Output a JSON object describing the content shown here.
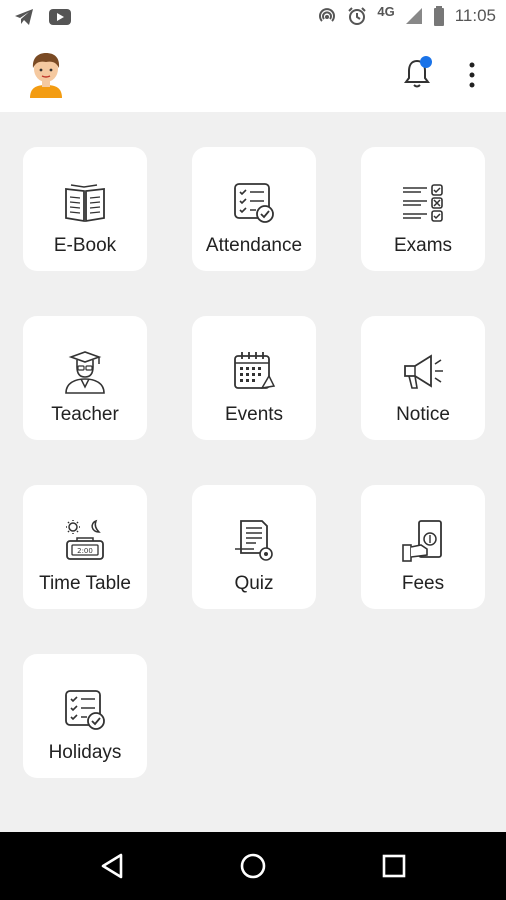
{
  "status_bar": {
    "network": "4G",
    "time": "11:05",
    "icons": [
      "telegram-icon",
      "youtube-icon",
      "hotspot-icon",
      "alarm-icon",
      "signal-icon",
      "battery-icon"
    ]
  },
  "app_bar": {
    "avatar": "avatar-boy",
    "notification_icon": "bell-icon",
    "notification_badge_color": "#1a73e8",
    "menu_icon": "more-vert-icon"
  },
  "tiles": [
    {
      "label": "E-Book",
      "icon": "book-icon"
    },
    {
      "label": "Attendance",
      "icon": "checklist-icon"
    },
    {
      "label": "Exams",
      "icon": "exam-icon"
    },
    {
      "label": "Teacher",
      "icon": "teacher-icon"
    },
    {
      "label": "Events",
      "icon": "calendar-icon"
    },
    {
      "label": "Notice",
      "icon": "megaphone-icon"
    },
    {
      "label": "Time Table",
      "icon": "clock-icon"
    },
    {
      "label": "Quiz",
      "icon": "quiz-icon"
    },
    {
      "label": "Fees",
      "icon": "money-icon"
    },
    {
      "label": "Holidays",
      "icon": "checklist-icon"
    }
  ],
  "nav_bar": {
    "buttons": [
      "back-icon",
      "home-icon",
      "recents-icon"
    ]
  }
}
